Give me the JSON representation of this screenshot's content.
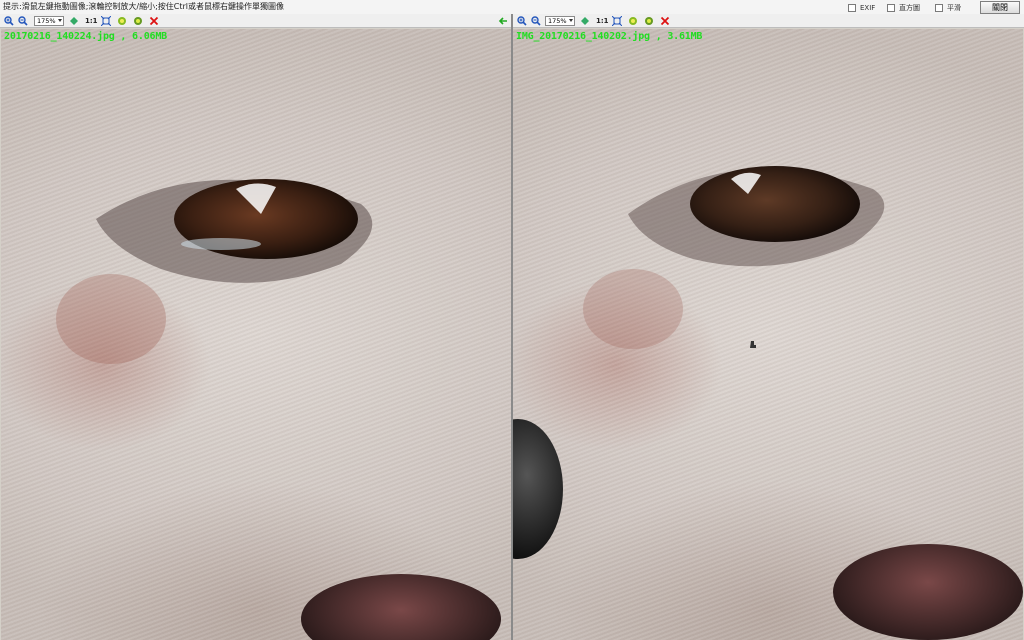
{
  "hint": "提示:滑鼠左鍵拖動圖像;滾輪控制放大/縮小;按住Ctrl或者鼠標右鍵操作單獨圖像",
  "options": [
    {
      "label": "EXIF",
      "checked": false
    },
    {
      "label": "直方圖",
      "checked": false
    },
    {
      "label": "平滑",
      "checked": false
    }
  ],
  "close_label": "關閉",
  "left": {
    "zoom": "175%",
    "ratio": "1:1",
    "file_label": "20170216_140224.jpg , 6.06MB"
  },
  "right": {
    "zoom": "175%",
    "ratio": "1:1",
    "file_label": "IMG_20170216_140202.jpg , 3.61MB"
  },
  "colors": {
    "label_green": "#22dd22",
    "delete_red": "#dd1111",
    "icon_blue": "#2255bb"
  }
}
